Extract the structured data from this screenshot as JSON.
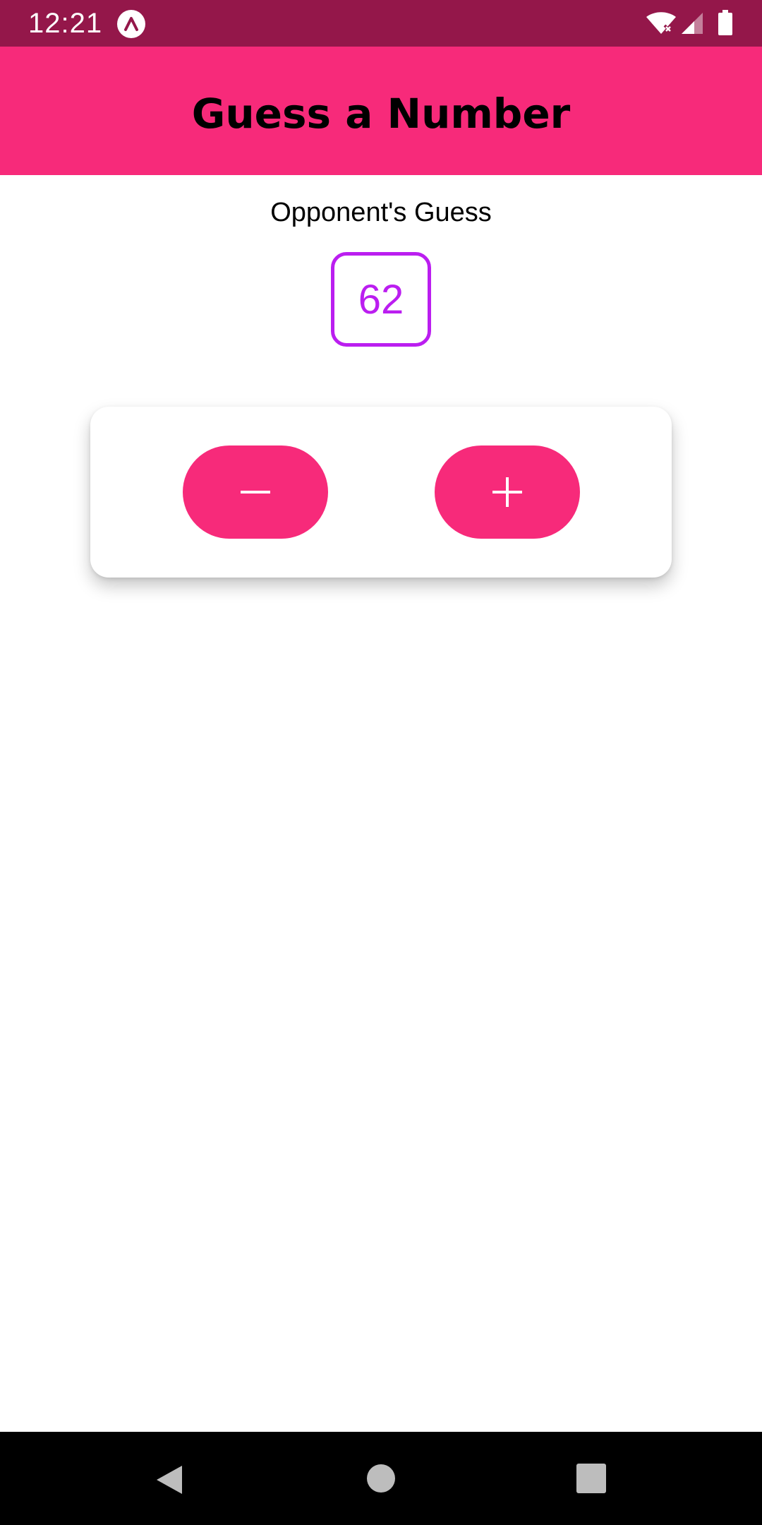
{
  "status_bar": {
    "time": "12:21",
    "app_icon": "expo-a-icon",
    "wifi_icon": "wifi-no-internet-icon",
    "signal_icon": "cell-signal-icon",
    "battery_icon": "battery-full-icon",
    "background_color": "#94174a"
  },
  "header": {
    "title": "Guess a Number",
    "background_color": "#f72a7a"
  },
  "game": {
    "guess_label": "Opponent's Guess",
    "guess_value": "62",
    "accent_color": "#bb1ef0"
  },
  "controls": {
    "lower_icon": "minus-icon",
    "higher_icon": "plus-icon",
    "button_color": "#f72a7a"
  },
  "nav_bar": {
    "back_icon": "back-triangle-icon",
    "home_icon": "home-circle-icon",
    "recents_icon": "recents-square-icon"
  }
}
